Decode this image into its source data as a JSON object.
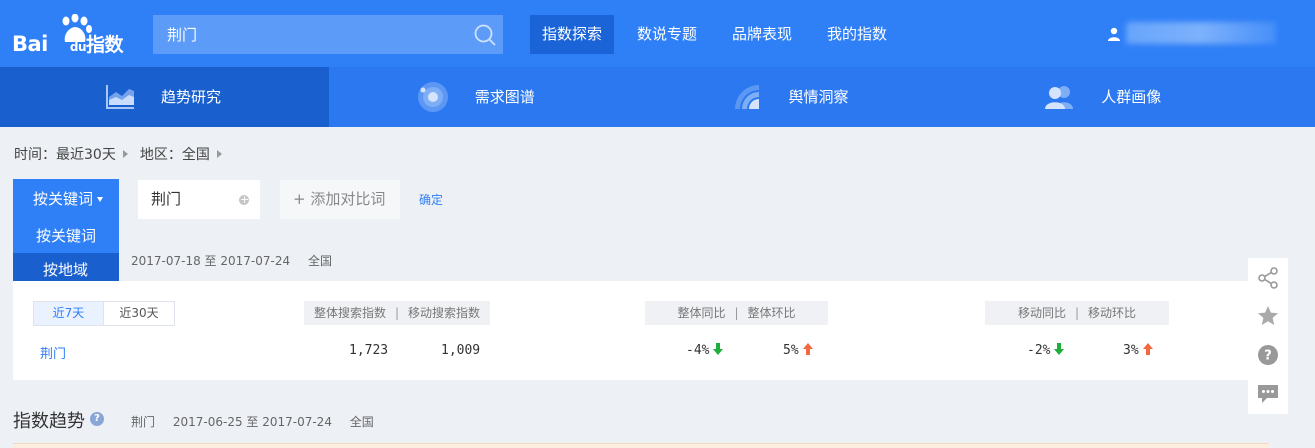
{
  "brand": {
    "logo_text": "Bai",
    "logo_du": "du",
    "logo_suffix": "指数"
  },
  "search": {
    "value": "荆门"
  },
  "nav": [
    {
      "label": "指数探索",
      "active": true
    },
    {
      "label": "数说专题"
    },
    {
      "label": "品牌表现"
    },
    {
      "label": "我的指数"
    }
  ],
  "subnav": [
    {
      "label": "趋势研究",
      "icon": "trend-chart-icon",
      "active": true
    },
    {
      "label": "需求图谱",
      "icon": "demand-graph-icon"
    },
    {
      "label": "舆情洞察",
      "icon": "sentiment-icon"
    },
    {
      "label": "人群画像",
      "icon": "crowd-portrait-icon"
    }
  ],
  "filter": {
    "time": "时间：最近30天",
    "region": "地区：全国"
  },
  "mode": {
    "selected": "按关键词",
    "options": [
      "按关键词",
      "按地域"
    ]
  },
  "keyword": {
    "value": "荆门",
    "add_label": "+ 添加对比词",
    "confirm": "确定"
  },
  "date_line": {
    "range": "2017-07-18 至 2017-07-24",
    "region": "全国"
  },
  "card": {
    "tabs": [
      "近7天",
      "近30天"
    ],
    "header1": [
      "整体搜索指数",
      "移动搜索指数"
    ],
    "header2": [
      "整体同比",
      "整体环比"
    ],
    "header3": [
      "移动同比",
      "移动环比"
    ],
    "row": {
      "keyword": "荆门",
      "overall_index": "1,723",
      "mobile_index": "1,009",
      "overall_yoy": "-4%",
      "overall_mom": "5%",
      "mobile_yoy": "-2%",
      "mobile_mom": "3%"
    }
  },
  "trend": {
    "title": "指数趋势",
    "help": "?",
    "keyword": "荆门",
    "range": "2017-06-25 至 2017-07-24",
    "region": "全国"
  },
  "colors": {
    "primary": "#2f7ff7",
    "down": "#1fae3a",
    "up": "#f2683f"
  }
}
